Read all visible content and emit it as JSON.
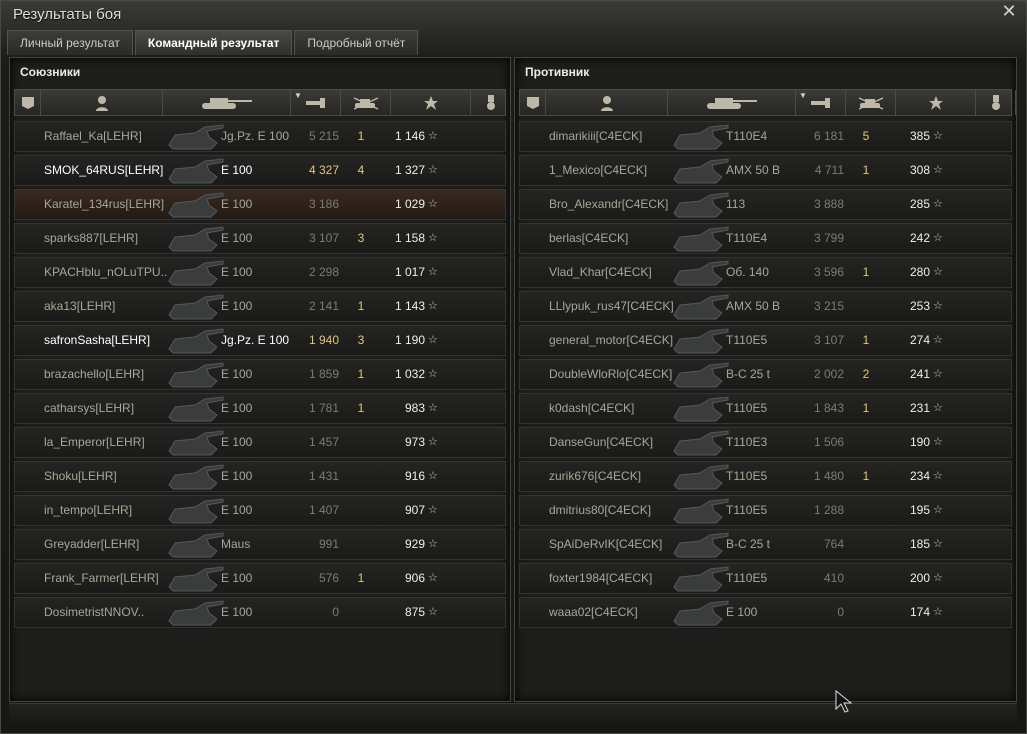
{
  "window": {
    "title": "Результаты боя"
  },
  "tabs": [
    {
      "label": "Личный результат",
      "active": false
    },
    {
      "label": "Командный результат",
      "active": true
    },
    {
      "label": "Подробный отчёт",
      "active": false
    }
  ],
  "columns_icons": [
    "badge-icon",
    "player-icon",
    "tank-icon",
    "damage-icon",
    "kills-icon",
    "xp-star-icon",
    "medal-icon"
  ],
  "allies": {
    "title": "Союзники",
    "rows": [
      {
        "name": "Raffael_Ka[LEHR]",
        "vehicle": "Jg.Pz. E 100",
        "damage": "5 215",
        "kills": "1",
        "xp": "1 146",
        "bright": false,
        "self": false,
        "top": false
      },
      {
        "name": "SMOK_64RUS[LEHR]",
        "vehicle": "E 100",
        "damage": "4 327",
        "kills": "4",
        "xp": "1 327",
        "bright": true,
        "self": false,
        "top": true
      },
      {
        "name": "Karatel_134rus[LEHR]",
        "vehicle": "E 100",
        "damage": "3 186",
        "kills": "",
        "xp": "1 029",
        "bright": false,
        "self": true,
        "top": false
      },
      {
        "name": "sparks887[LEHR]",
        "vehicle": "E 100",
        "damage": "3 107",
        "kills": "3",
        "xp": "1 158",
        "bright": false,
        "self": false,
        "top": false
      },
      {
        "name": "KPACHblu_nOLuTPU..",
        "vehicle": "E 100",
        "damage": "2 298",
        "kills": "",
        "xp": "1 017",
        "bright": false,
        "self": false,
        "top": false
      },
      {
        "name": "aka13[LEHR]",
        "vehicle": "E 100",
        "damage": "2 141",
        "kills": "1",
        "xp": "1 143",
        "bright": false,
        "self": false,
        "top": false
      },
      {
        "name": "safronSasha[LEHR]",
        "vehicle": "Jg.Pz. E 100",
        "damage": "1 940",
        "kills": "3",
        "xp": "1 190",
        "bright": true,
        "self": false,
        "top": true
      },
      {
        "name": "brazachello[LEHR]",
        "vehicle": "E 100",
        "damage": "1 859",
        "kills": "1",
        "xp": "1 032",
        "bright": false,
        "self": false,
        "top": false
      },
      {
        "name": "catharsys[LEHR]",
        "vehicle": "E 100",
        "damage": "1 781",
        "kills": "1",
        "xp": "983",
        "bright": false,
        "self": false,
        "top": false
      },
      {
        "name": "la_Emperor[LEHR]",
        "vehicle": "E 100",
        "damage": "1 457",
        "kills": "",
        "xp": "973",
        "bright": false,
        "self": false,
        "top": false
      },
      {
        "name": "Shoku[LEHR]",
        "vehicle": "E 100",
        "damage": "1 431",
        "kills": "",
        "xp": "916",
        "bright": false,
        "self": false,
        "top": false
      },
      {
        "name": "in_tempo[LEHR]",
        "vehicle": "E 100",
        "damage": "1 407",
        "kills": "",
        "xp": "907",
        "bright": false,
        "self": false,
        "top": false
      },
      {
        "name": "Greyadder[LEHR]",
        "vehicle": "Maus",
        "damage": "991",
        "kills": "",
        "xp": "929",
        "bright": false,
        "self": false,
        "top": false
      },
      {
        "name": "Frank_Farmer[LEHR]",
        "vehicle": "E 100",
        "damage": "576",
        "kills": "1",
        "xp": "906",
        "bright": false,
        "self": false,
        "top": false
      },
      {
        "name": "DosimetristNNOV..",
        "vehicle": "E 100",
        "damage": "0",
        "kills": "",
        "xp": "875",
        "bright": false,
        "self": false,
        "top": false
      }
    ]
  },
  "enemies": {
    "title": "Противник",
    "rows": [
      {
        "name": "dimarikiii[C4ECK]",
        "vehicle": "T110E4",
        "damage": "6 181",
        "kills": "5",
        "xp": "385"
      },
      {
        "name": "1_Mexico[C4ECK]",
        "vehicle": "AMX 50 B",
        "damage": "4 711",
        "kills": "1",
        "xp": "308"
      },
      {
        "name": "Bro_Alexandr[C4ECK]",
        "vehicle": "113",
        "damage": "3 888",
        "kills": "",
        "xp": "285"
      },
      {
        "name": "berlas[C4ECK]",
        "vehicle": "T110E4",
        "damage": "3 799",
        "kills": "",
        "xp": "242"
      },
      {
        "name": "Vlad_Khar[C4ECK]",
        "vehicle": "Об. 140",
        "damage": "3 596",
        "kills": "1",
        "xp": "280"
      },
      {
        "name": "LLlypuk_rus47[C4ECK]",
        "vehicle": "AMX 50 B",
        "damage": "3 215",
        "kills": "",
        "xp": "253"
      },
      {
        "name": "general_motor[C4ECK]",
        "vehicle": "T110E5",
        "damage": "3 107",
        "kills": "1",
        "xp": "274"
      },
      {
        "name": "DoubleWloRlo[C4ECK]",
        "vehicle": "B-C 25 t",
        "damage": "2 002",
        "kills": "2",
        "xp": "241"
      },
      {
        "name": "k0dash[C4ECK]",
        "vehicle": "T110E5",
        "damage": "1 843",
        "kills": "1",
        "xp": "231"
      },
      {
        "name": "DanseGun[C4ECK]",
        "vehicle": "T110E3",
        "damage": "1 506",
        "kills": "",
        "xp": "190"
      },
      {
        "name": "zurik676[C4ECK]",
        "vehicle": "T110E5",
        "damage": "1 480",
        "kills": "1",
        "xp": "234"
      },
      {
        "name": "dmitrius80[C4ECK]",
        "vehicle": "T110E5",
        "damage": "1 288",
        "kills": "",
        "xp": "195"
      },
      {
        "name": "SpAiDeRvIK[C4ECK]",
        "vehicle": "B-C 25 t",
        "damage": "764",
        "kills": "",
        "xp": "185"
      },
      {
        "name": "foxter1984[C4ECK]",
        "vehicle": "T110E5",
        "damage": "410",
        "kills": "",
        "xp": "200"
      },
      {
        "name": "waaa02[C4ECK]",
        "vehicle": "E 100",
        "damage": "0",
        "kills": "",
        "xp": "174"
      }
    ]
  },
  "colors": {
    "accent": "#e1c777",
    "self_row": "#3a2a20",
    "text": "#a9a698"
  }
}
